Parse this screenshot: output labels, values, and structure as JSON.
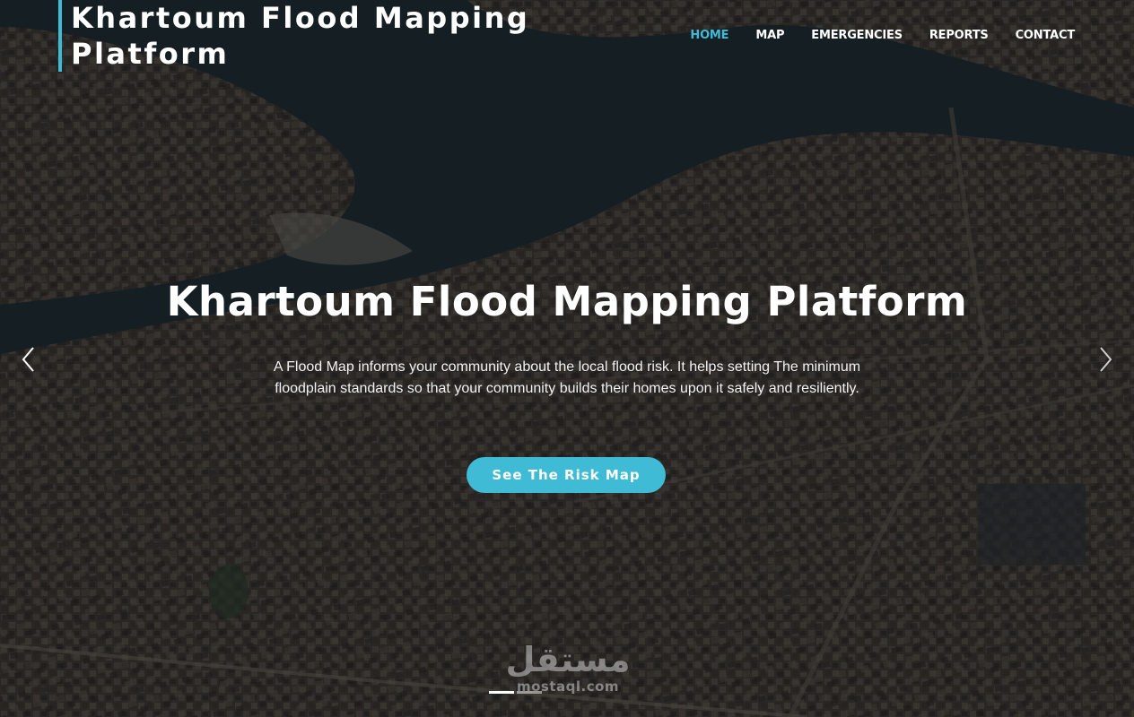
{
  "brand": {
    "title": "Khartoum Flood Mapping Platform"
  },
  "nav": {
    "items": [
      {
        "label": "HOME",
        "active": true
      },
      {
        "label": "MAP"
      },
      {
        "label": "EMERGENCIES"
      },
      {
        "label": "REPORTS"
      },
      {
        "label": "CONTACT"
      }
    ]
  },
  "hero": {
    "title": "Khartoum Flood Mapping Platform",
    "description": "A Flood Map informs your community about the local flood risk. It helps setting The minimum floodplain standards so that your community builds their homes upon it safely and resiliently.",
    "cta_label": "See The Risk Map",
    "prev_icon": "chevron-left-icon",
    "next_icon": "chevron-right-icon",
    "slides_total": 2,
    "active_slide": 1
  },
  "watermark": {
    "arabic": "مستقل",
    "latin": "mostaql.com"
  },
  "colors": {
    "accent": "#3fbbd5",
    "text": "#ffffff"
  }
}
